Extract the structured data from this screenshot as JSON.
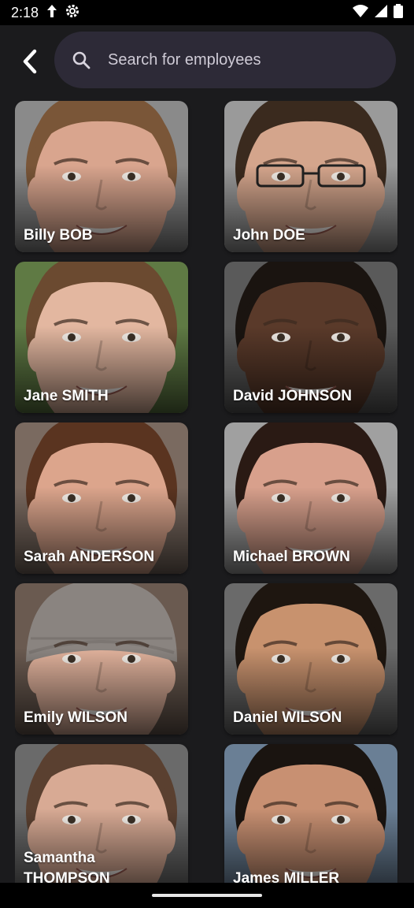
{
  "status_bar": {
    "time": "2:18",
    "icons": [
      "navigation-icon",
      "settings-gear-icon",
      "wifi-icon",
      "signal-icon",
      "battery-icon"
    ]
  },
  "header": {
    "back_icon": "chevron-left-icon",
    "search": {
      "icon": "search-icon",
      "placeholder": "Search for employees"
    }
  },
  "employees": [
    {
      "name": "Billy BOB",
      "skin": "#d9a58e",
      "hair": "#7a5638",
      "bg": "#8a8a8a"
    },
    {
      "name": "John DOE",
      "skin": "#d4a58c",
      "hair": "#3a2a1e",
      "bg": "#9a9a9a",
      "glasses": true
    },
    {
      "name": "Jane SMITH",
      "skin": "#e3b7a0",
      "hair": "#6b4a30",
      "bg": "#5f7a44"
    },
    {
      "name": "David JOHNSON",
      "skin": "#5a3a2a",
      "hair": "#1a1410",
      "bg": "#5a5a5a"
    },
    {
      "name": "Sarah ANDERSON",
      "skin": "#dca58c",
      "hair": "#5a3420",
      "bg": "#7a6a60"
    },
    {
      "name": "Michael BROWN",
      "skin": "#d8a08c",
      "hair": "#2a1a14",
      "bg": "#a0a0a0"
    },
    {
      "name": "Emily WILSON",
      "skin": "#e1b29c",
      "hair": "#8a8480",
      "bg": "#6a5a50",
      "beanie": true
    },
    {
      "name": "Daniel WILSON",
      "skin": "#c8926e",
      "hair": "#1e1610",
      "bg": "#6a6a6a"
    },
    {
      "name": "Samantha THOMPSON",
      "skin": "#d8aa94",
      "hair": "#5a4030",
      "bg": "#6a6a6a"
    },
    {
      "name": "James MILLER",
      "skin": "#c89072",
      "hair": "#1a1410",
      "bg": "#6a7f95"
    }
  ]
}
